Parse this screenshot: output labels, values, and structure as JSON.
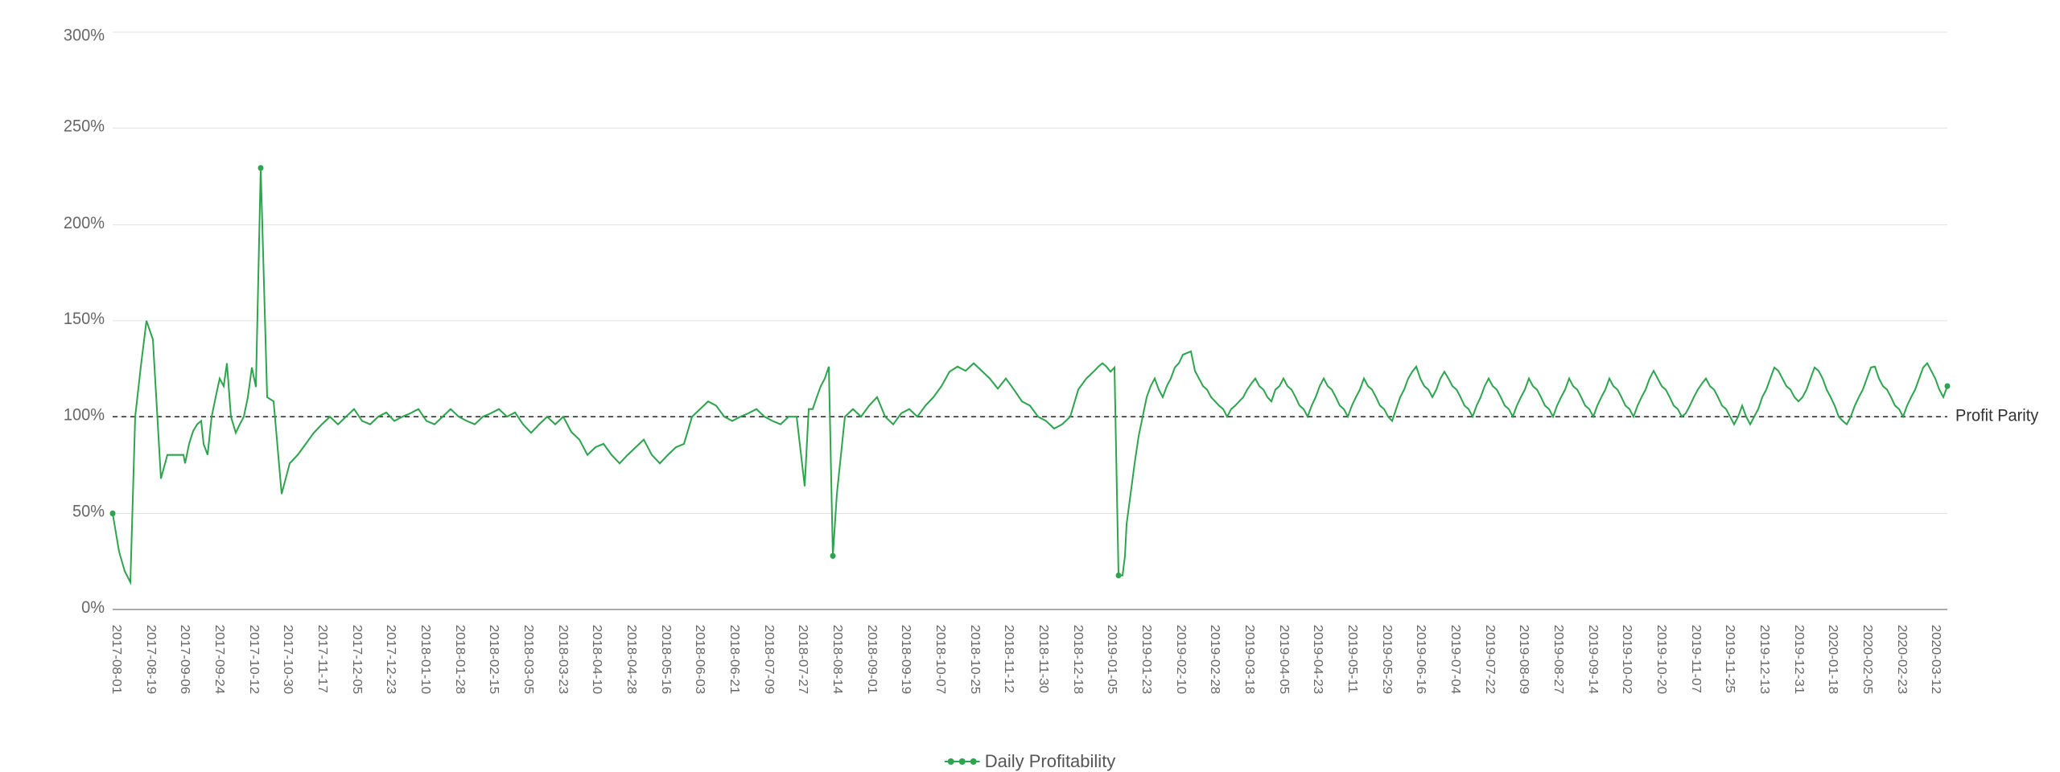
{
  "chart": {
    "title": "Daily Profitability",
    "y_axis_labels": [
      "0%",
      "50%",
      "100%",
      "150%",
      "200%",
      "250%",
      "300%"
    ],
    "parity_label": "Profit Parity",
    "legend_label": "Daily Profitability",
    "x_axis_dates": [
      "2017-08-01",
      "2017-08-19",
      "2017-09-06",
      "2017-09-24",
      "2017-10-12",
      "2017-10-30",
      "2017-11-17",
      "2017-12-05",
      "2017-12-23",
      "2018-01-10",
      "2018-01-28",
      "2018-02-15",
      "2018-03-05",
      "2018-03-23",
      "2018-04-10",
      "2018-04-28",
      "2018-05-16",
      "2018-06-03",
      "2018-06-21",
      "2018-07-09",
      "2018-07-27",
      "2018-08-14",
      "2018-09-01",
      "2018-09-19",
      "2018-10-07",
      "2018-10-25",
      "2018-11-12",
      "2018-11-30",
      "2018-12-18",
      "2019-01-05",
      "2019-01-23",
      "2019-02-10",
      "2019-02-28",
      "2019-03-18",
      "2019-04-05",
      "2019-04-23",
      "2019-05-11",
      "2019-05-29",
      "2019-06-16",
      "2019-07-04",
      "2019-07-22",
      "2019-08-09",
      "2019-08-27",
      "2019-09-14",
      "2019-10-02",
      "2019-10-20",
      "2019-11-07",
      "2019-11-25",
      "2019-12-13",
      "2019-12-31",
      "2020-01-18",
      "2020-02-05",
      "2020-02-23",
      "2020-03-12"
    ]
  }
}
